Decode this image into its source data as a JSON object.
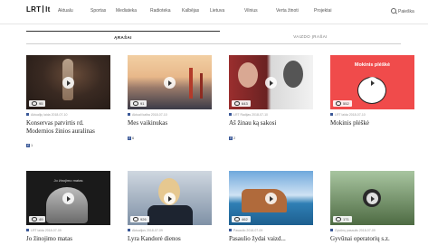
{
  "header": {
    "logo_left": "LRT",
    "logo_right": "lt",
    "nav": [
      "Aktualu",
      "Sportas",
      "Mediateka",
      "Radiotekа",
      "Kalbējas",
      "Lietuva",
      "Vilnius",
      "Verta žinoti",
      "Projektai"
    ],
    "search_label": "Paieška"
  },
  "tabs": [
    {
      "label": "Ąrašai",
      "active": true
    },
    {
      "label": "Vaizdo įrašai",
      "active": false
    }
  ],
  "cards": [
    {
      "views": "95",
      "meta": "Aktualijų laida 2018-07-10",
      "title": "Konservas patvirtis rd. Modernios žinios auralinas",
      "fb": "1"
    },
    {
      "views": "91",
      "meta": "Aktuali kalba 2018-07-10",
      "title": "Mes vaikinukas",
      "fb": "6"
    },
    {
      "views": "643",
      "meta": "LRT Radijas 2018-07-10",
      "title": "Aš žinau ką sakosi",
      "fb": "2"
    },
    {
      "views": "552",
      "meta": "LRT laida 2018-07-10",
      "title": "Mokinis plėškė",
      "fb": "",
      "banner": "Mokinis plėškė"
    },
    {
      "views": "49",
      "meta": "LRT laida 2018-07-09",
      "title": "Jo žinojimo matas",
      "fb": "",
      "banner": "Jo žinojimo matas"
    },
    {
      "views": "926",
      "meta": "Aktualijos 2018-07-09",
      "title": "Lyra Kandorė dienos",
      "fb": ""
    },
    {
      "views": "462",
      "meta": "Pasaulio 2018-07-09",
      "title": "Pasaulio žydai vaizd...",
      "fb": ""
    },
    {
      "views": "171",
      "meta": "Gyvūnų pasaulis 2018-07-09",
      "title": "Gyvūnai operatorių s.z.",
      "fb": ""
    }
  ]
}
